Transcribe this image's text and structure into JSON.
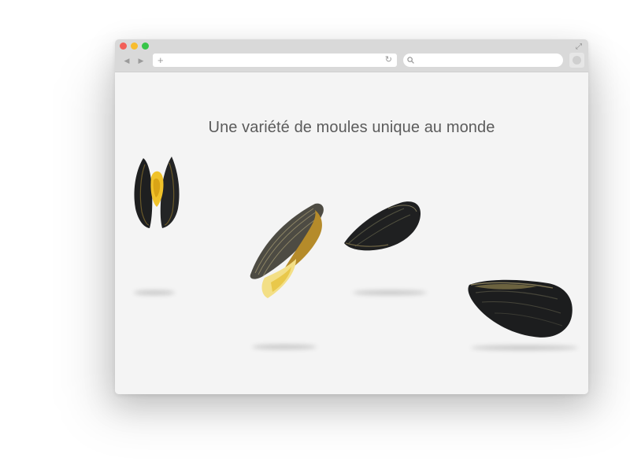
{
  "browser": {
    "window_controls": [
      "close",
      "minimize",
      "maximize"
    ],
    "icons": {
      "back": "back-arrow-icon",
      "forward": "forward-arrow-icon",
      "new_tab": "plus-icon",
      "reload": "reload-icon",
      "search": "search-icon",
      "expand": "expand-icon"
    },
    "address_value": "",
    "search_value": ""
  },
  "page": {
    "headline": "Une variété de moules unique au monde",
    "mussels": [
      {
        "name": "mussel-open-front"
      },
      {
        "name": "mussel-open-tilted"
      },
      {
        "name": "mussel-closed-small"
      },
      {
        "name": "mussel-closed-large"
      }
    ]
  },
  "colors": {
    "chrome": "#d9d9d9",
    "page_bg": "#f4f4f4",
    "close": "#f25f58",
    "minimize": "#f8bd2e",
    "maximize": "#37c548",
    "headline": "#5b5b5b",
    "shell": "#1e1f20",
    "meat": "#f0c22a"
  }
}
